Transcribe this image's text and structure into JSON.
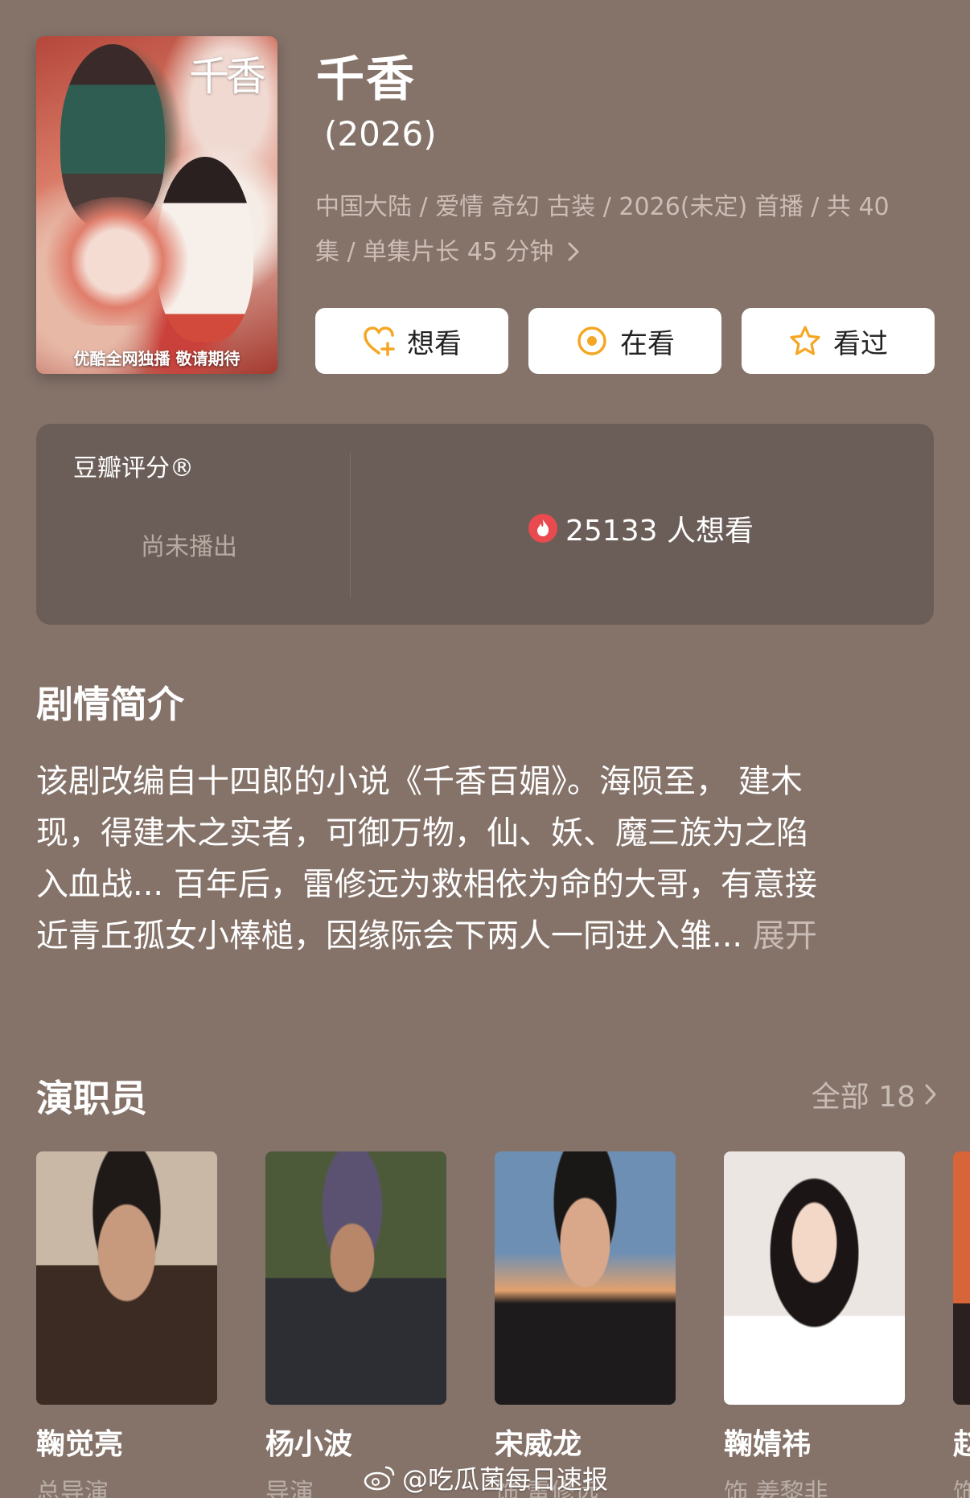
{
  "poster": {
    "title": "千香",
    "caption": "优酷全网独播 敬请期待"
  },
  "title": "千香",
  "year": "(2026)",
  "meta_line1": "中国大陆 / 爱情 奇幻 古装 / 2026(未定) 首播 / 共 40",
  "meta_line2": "集 / 单集片长 45 分钟",
  "actions": {
    "want": "想看",
    "watching": "在看",
    "watched": "看过"
  },
  "rating": {
    "brand": "豆瓣评分®",
    "status": "尚未播出",
    "wish_count": "25133 人想看"
  },
  "synopsis": {
    "heading": "剧情简介",
    "lines": [
      "该剧改编自十四郎的小说《千香百媚》。海陨至， 建木",
      "现，得建木之实者，可御万物，仙、妖、魔三族为之陷",
      "入血战... 百年后，雷修远为救相依为命的大哥，有意接",
      "近青丘孤女小棒槌，因缘际会下两人一同进入雏..."
    ],
    "expand": "展开"
  },
  "cast": {
    "heading": "演职员",
    "all_label": "全部 18",
    "members": [
      {
        "name": "鞠觉亮",
        "role": "总导演"
      },
      {
        "name": "杨小波",
        "role": "导演"
      },
      {
        "name": "宋威龙",
        "role": "饰 雷修远"
      },
      {
        "name": "鞠婧祎",
        "role": "饰 姜黎非"
      },
      {
        "name": "赵",
        "role": "饰"
      }
    ]
  },
  "watermark": "@吃瓜菌每日速报",
  "colors": {
    "background": "#85736a",
    "card": "#6b5e58",
    "accent": "#f5a623",
    "fire": "#e94a4f"
  }
}
